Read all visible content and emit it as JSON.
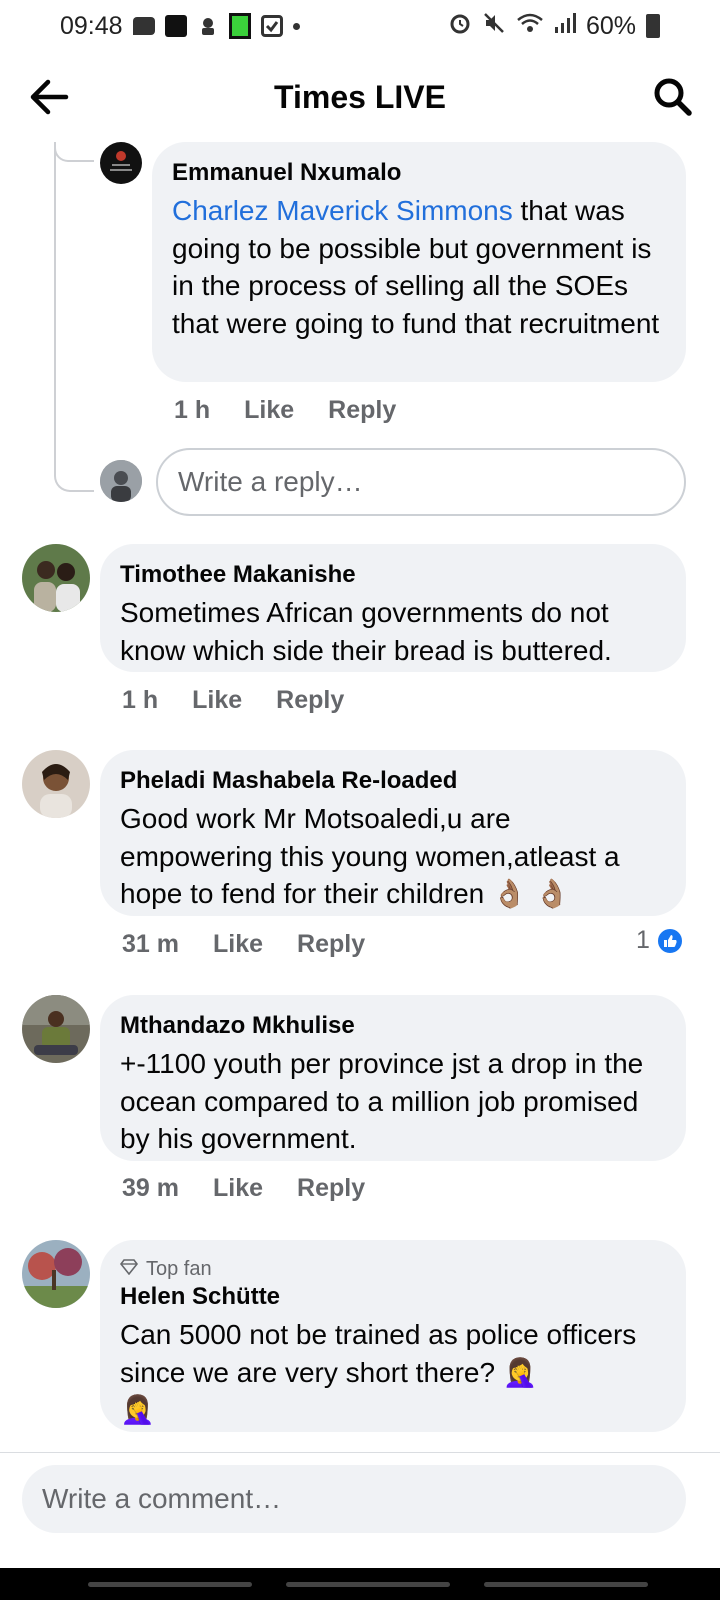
{
  "status_bar": {
    "time": "09:48",
    "battery": "60%"
  },
  "header": {
    "title": "Times LIVE"
  },
  "comments": [
    {
      "name": "Emmanuel Nxumalo",
      "mention": "Charlez Maverick Simmons",
      "text": " that was going to be possible but government is in the process of selling all the SOEs that were going to fund that recruitment",
      "time": "1 h",
      "like": "Like",
      "reply": "Reply"
    },
    {
      "name": "Timothee Makanishe",
      "text": "Sometimes African governments do not know which side their bread is buttered.",
      "time": "1 h",
      "like": "Like",
      "reply": "Reply"
    },
    {
      "name": "Pheladi Mashabela Re-loaded",
      "text": "Good work Mr Motsoaledi,u are empowering this young women,atleast a hope to fend for their children 👌🏽 👌🏽",
      "time": "31 m",
      "like": "Like",
      "reply": "Reply",
      "reactions": "1"
    },
    {
      "name": "Mthandazo Mkhulise",
      "text": "+-1100 youth per province jst a drop in the ocean compared to a million job promised by his government.",
      "time": "39 m",
      "like": "Like",
      "reply": "Reply"
    },
    {
      "badge": "Top fan",
      "name": "Helen Schütte",
      "text": "Can 5000 not be trained as police officers since we are very short there? 🤦‍♀️",
      "emoji_line": "🤦‍♀️"
    }
  ],
  "reply_input": {
    "placeholder": "Write a reply…"
  },
  "comment_input": {
    "placeholder": "Write a comment…"
  },
  "colors": {
    "mention": "#216fdb",
    "bubble": "#f0f2f5",
    "like_blue": "#1877f2"
  }
}
